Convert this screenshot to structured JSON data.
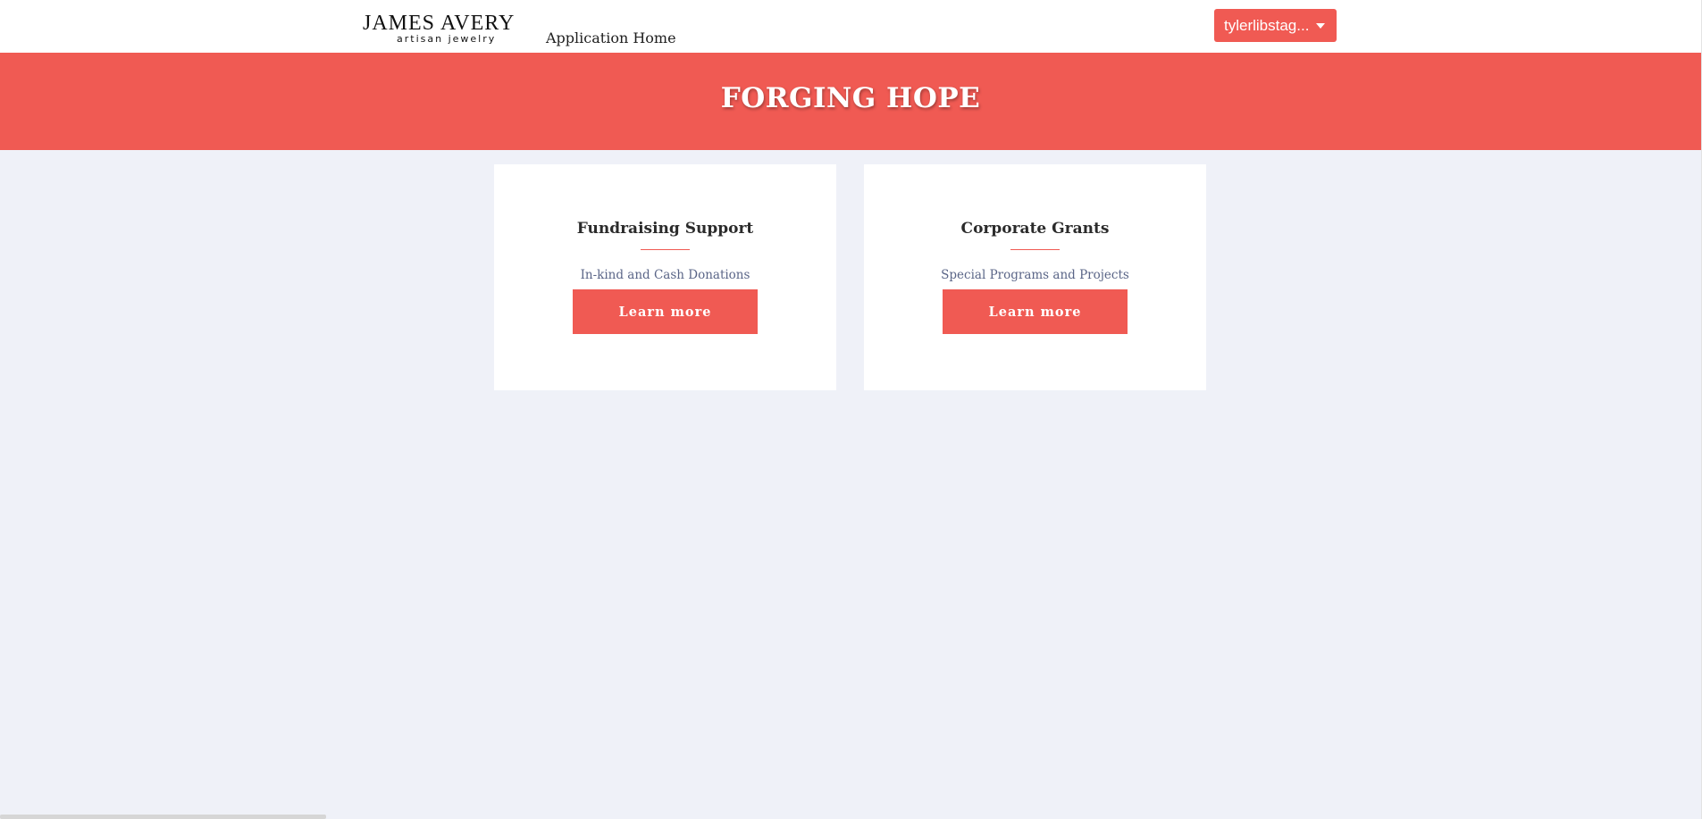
{
  "header": {
    "logo": {
      "brand_left": "JAMES",
      "brand_right": "AVERY",
      "tagline": "artisan jewelry"
    },
    "nav_link": "Application Home",
    "user_menu": {
      "label": "tylerlibstag...",
      "icon": "caret-down-icon"
    }
  },
  "banner": {
    "title": "FORGING HOPE"
  },
  "cards": [
    {
      "title": "Fundraising Support",
      "subtitle": "In-kind and Cash Donations",
      "button_label": "Learn more"
    },
    {
      "title": "Corporate Grants",
      "subtitle": "Special Programs and Projects",
      "button_label": "Learn more"
    }
  ],
  "colors": {
    "accent": "#f05a53",
    "page_background": "#eff1f8",
    "card_background": "#ffffff",
    "subtitle_text": "#5a6587"
  }
}
